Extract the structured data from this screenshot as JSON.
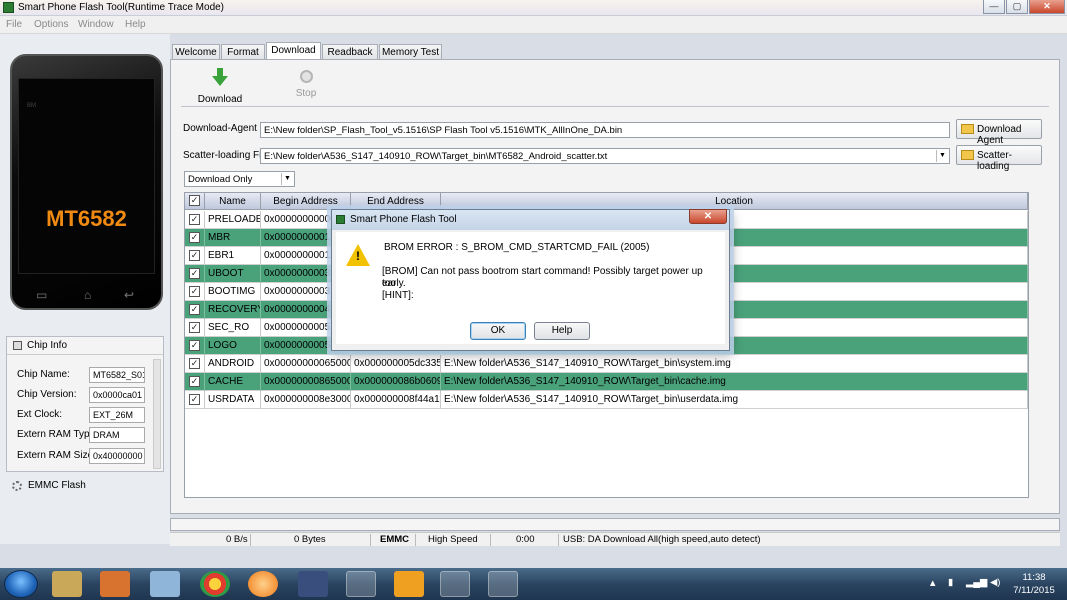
{
  "window": {
    "title": "Smart Phone Flash Tool(Runtime Trace Mode)",
    "controls": {
      "minimize": "—",
      "maximize": "▢",
      "close": "✕"
    }
  },
  "menu": [
    "File",
    "Options",
    "Window",
    "Help"
  ],
  "phone": {
    "chip_label": "MT6582",
    "brand": "BM"
  },
  "chip_info": {
    "header": "Chip Info",
    "fields": [
      {
        "label": "Chip Name:",
        "value": "MT6582_S01"
      },
      {
        "label": "Chip Version:",
        "value": "0x0000ca01"
      },
      {
        "label": "Ext Clock:",
        "value": "EXT_26M"
      },
      {
        "label": "Extern RAM Type:",
        "value": "DRAM"
      },
      {
        "label": "Extern RAM Size:",
        "value": "0x40000000"
      }
    ]
  },
  "emmc_panel": {
    "label": "EMMC Flash"
  },
  "tabs": [
    "Welcome",
    "Format",
    "Download",
    "Readback",
    "Memory Test"
  ],
  "active_tab": "Download",
  "toolbar": {
    "download_label": "Download",
    "stop_label": "Stop"
  },
  "download_agent": {
    "label": "Download-Agent",
    "value": "E:\\New folder\\SP_Flash_Tool_v5.1516\\SP Flash Tool v5.1516\\MTK_AllInOne_DA.bin",
    "button": "Download Agent"
  },
  "scatter": {
    "label": "Scatter-loading File",
    "value": "E:\\New folder\\A536_S147_140910_ROW\\Target_bin\\MT6582_Android_scatter.txt",
    "button": "Scatter-loading"
  },
  "mode_select": {
    "value": "Download Only"
  },
  "table": {
    "headers": [
      "Name",
      "Begin Address",
      "End Address",
      "Location"
    ],
    "rows": [
      {
        "name": "PRELOADER",
        "begin": "0x000000000000",
        "end": "",
        "location": ".bin",
        "checked": "✓",
        "selected": false
      },
      {
        "name": "MBR",
        "begin": "0x000000000140",
        "end": "",
        "location": "",
        "checked": "✓",
        "selected": true
      },
      {
        "name": "EBR1",
        "begin": "0x000000000148",
        "end": "",
        "location": "",
        "checked": "✓",
        "selected": false
      },
      {
        "name": "UBOOT",
        "begin": "0x000000000312",
        "end": "",
        "location": "",
        "checked": "✓",
        "selected": true
      },
      {
        "name": "BOOTIMG",
        "begin": "0x000000000318",
        "end": "",
        "location": "",
        "checked": "✓",
        "selected": false
      },
      {
        "name": "RECOVERY",
        "begin": "0x000000000418",
        "end": "",
        "location": "",
        "checked": "✓",
        "selected": true
      },
      {
        "name": "SEC_RO",
        "begin": "0x000000000518",
        "end": "",
        "location": "",
        "checked": "✓",
        "selected": false
      },
      {
        "name": "LOGO",
        "begin": "0x000000000580",
        "end": "",
        "location": "",
        "checked": "✓",
        "selected": true
      },
      {
        "name": "ANDROID",
        "begin": "0x0000000006500000",
        "end": "0x000000005dc335a7",
        "location": "E:\\New folder\\A536_S147_140910_ROW\\Target_bin\\system.img",
        "checked": "✓",
        "selected": false
      },
      {
        "name": "CACHE",
        "begin": "0x0000000086500000",
        "end": "0x000000086b06093",
        "location": "E:\\New folder\\A536_S147_140910_ROW\\Target_bin\\cache.img",
        "checked": "✓",
        "selected": true
      },
      {
        "name": "USRDATA",
        "begin": "0x000000008e300000",
        "end": "0x000000008f44a1fb",
        "location": "E:\\New folder\\A536_S147_140910_ROW\\Target_bin\\userdata.img",
        "checked": "✓",
        "selected": false
      }
    ]
  },
  "status_bar": {
    "speed": "0 B/s",
    "bytes": "0 Bytes",
    "storage": "EMMC",
    "usb_speed": "High Speed",
    "time": "0:00",
    "message": "USB: DA Download All(high speed,auto detect)"
  },
  "dialog": {
    "title": "Smart Phone Flash Tool",
    "error": "BROM ERROR : S_BROM_CMD_STARTCMD_FAIL (2005)",
    "message_line1": "[BROM] Can not pass bootrom start command! Possibly target power up too",
    "message_line2": "early.",
    "hint": "[HINT]:",
    "ok": "OK",
    "help": "Help"
  },
  "taskbar": {
    "clock_time": "11:38",
    "clock_date": "7/11/2015",
    "apps": [
      "start-button",
      "file-explorer",
      "media-player",
      "notepad",
      "chrome",
      "burning-app",
      "dev-cpp",
      "sync-app",
      "apps-grid",
      "flash-tool",
      "paint-app"
    ]
  },
  "colors": {
    "selected_row": "#4aa27a",
    "chip_label": "#f08a12",
    "download_arrow": "#3aa23a",
    "warning": "#f2c200"
  }
}
